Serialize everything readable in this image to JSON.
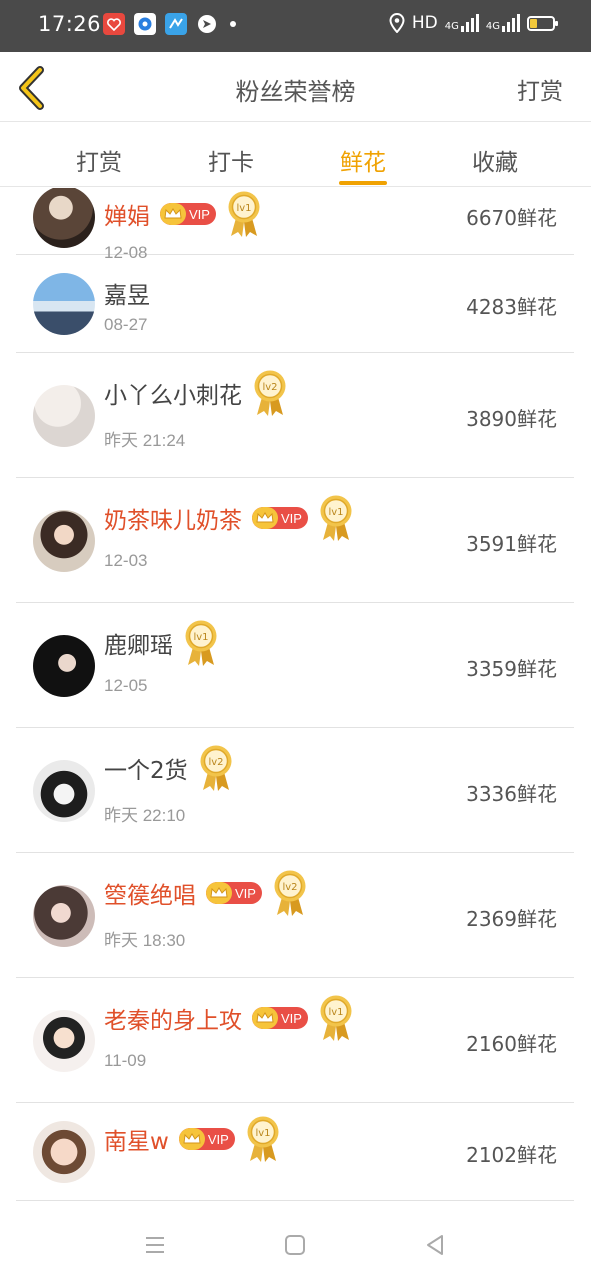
{
  "status_bar": {
    "time": "17:26",
    "hd": "HD",
    "net1": "4G",
    "net2": "4G",
    "app_icons": [
      "heart-app-icon",
      "browser-app-icon",
      "map-app-icon",
      "compass-app-icon"
    ]
  },
  "header": {
    "title": "粉丝荣誉榜",
    "action": "打赏",
    "back_icon": "chevron-left-icon"
  },
  "tabs": [
    {
      "label": "打赏",
      "active": false
    },
    {
      "label": "打卡",
      "active": false
    },
    {
      "label": "鲜花",
      "active": true
    },
    {
      "label": "收藏",
      "active": false
    }
  ],
  "list": [
    {
      "name": "婵娟",
      "vip": true,
      "medal": "lv1",
      "date": "12-08",
      "count": "6670鲜花"
    },
    {
      "name": "嘉昱",
      "vip": false,
      "medal": "",
      "date": "08-27",
      "count": "4283鲜花"
    },
    {
      "name": "小丫么小刺花",
      "vip": false,
      "medal": "lv2",
      "date": "昨天 21:24",
      "count": "3890鲜花"
    },
    {
      "name": "奶茶味儿奶茶",
      "vip": true,
      "medal": "lv1",
      "date": "12-03",
      "count": "3591鲜花"
    },
    {
      "name": "鹿卿瑶",
      "vip": false,
      "medal": "lv1",
      "date": "12-05",
      "count": "3359鲜花"
    },
    {
      "name": "一个2货",
      "vip": false,
      "medal": "lv2",
      "date": "昨天 22:10",
      "count": "3336鲜花"
    },
    {
      "name": "箜篌绝唱",
      "vip": true,
      "medal": "lv2",
      "date": "昨天 18:30",
      "count": "2369鲜花"
    },
    {
      "name": "老秦的身上攻",
      "vip": true,
      "medal": "lv1",
      "date": "11-09",
      "count": "2160鲜花"
    },
    {
      "name": "南星w",
      "vip": true,
      "medal": "lv1",
      "date": "",
      "count": "2102鲜花"
    }
  ],
  "vip_label": "VIP",
  "colors": {
    "accent": "#f0a202",
    "vip_name": "#e0502a",
    "vip_badge": "#e94f46",
    "crown": "#f6c43b"
  },
  "nav": {
    "menu_icon": "menu-icon",
    "home_icon": "home-square-icon",
    "back_icon": "back-triangle-icon"
  }
}
